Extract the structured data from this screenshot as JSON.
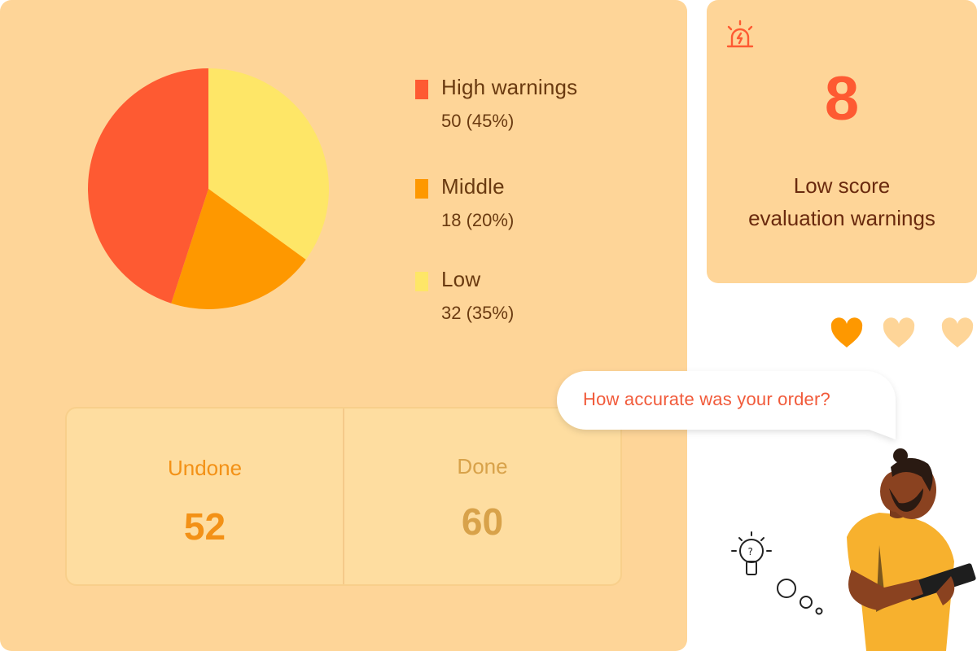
{
  "chart_data": {
    "type": "pie",
    "slices": [
      {
        "label": "High warnings",
        "value": 50,
        "percent": 45,
        "color": "#fe5a32"
      },
      {
        "label": "Middle",
        "value": 18,
        "percent": 20,
        "color": "#fe9800"
      },
      {
        "label": "Low",
        "value": 32,
        "percent": 35,
        "color": "#fee667"
      }
    ]
  },
  "legend": [
    {
      "label": "High warnings",
      "value_text": "50 (45%)",
      "color": "#fe5a32"
    },
    {
      "label": "Middle",
      "value_text": "18 (20%)",
      "color": "#fe9800"
    },
    {
      "label": "Low",
      "value_text": "32 (35%)",
      "color": "#fee667"
    }
  ],
  "stats": {
    "undone": {
      "label": "Undone",
      "value": "52"
    },
    "done": {
      "label": "Done",
      "value": "60"
    }
  },
  "warning_card": {
    "icon": "alarm-icon",
    "count": "8",
    "title_line1": "Low score",
    "title_line2": "evaluation warnings"
  },
  "rating": {
    "selected": 1,
    "total": 3,
    "icon": "heart-icon",
    "selected_color": "#fe9800",
    "unselected_color": "#fed598"
  },
  "question": "How accurate was your order?",
  "colors": {
    "panel": "#fed598",
    "accent": "#fe5a32",
    "text_dark": "#6a3a10"
  }
}
